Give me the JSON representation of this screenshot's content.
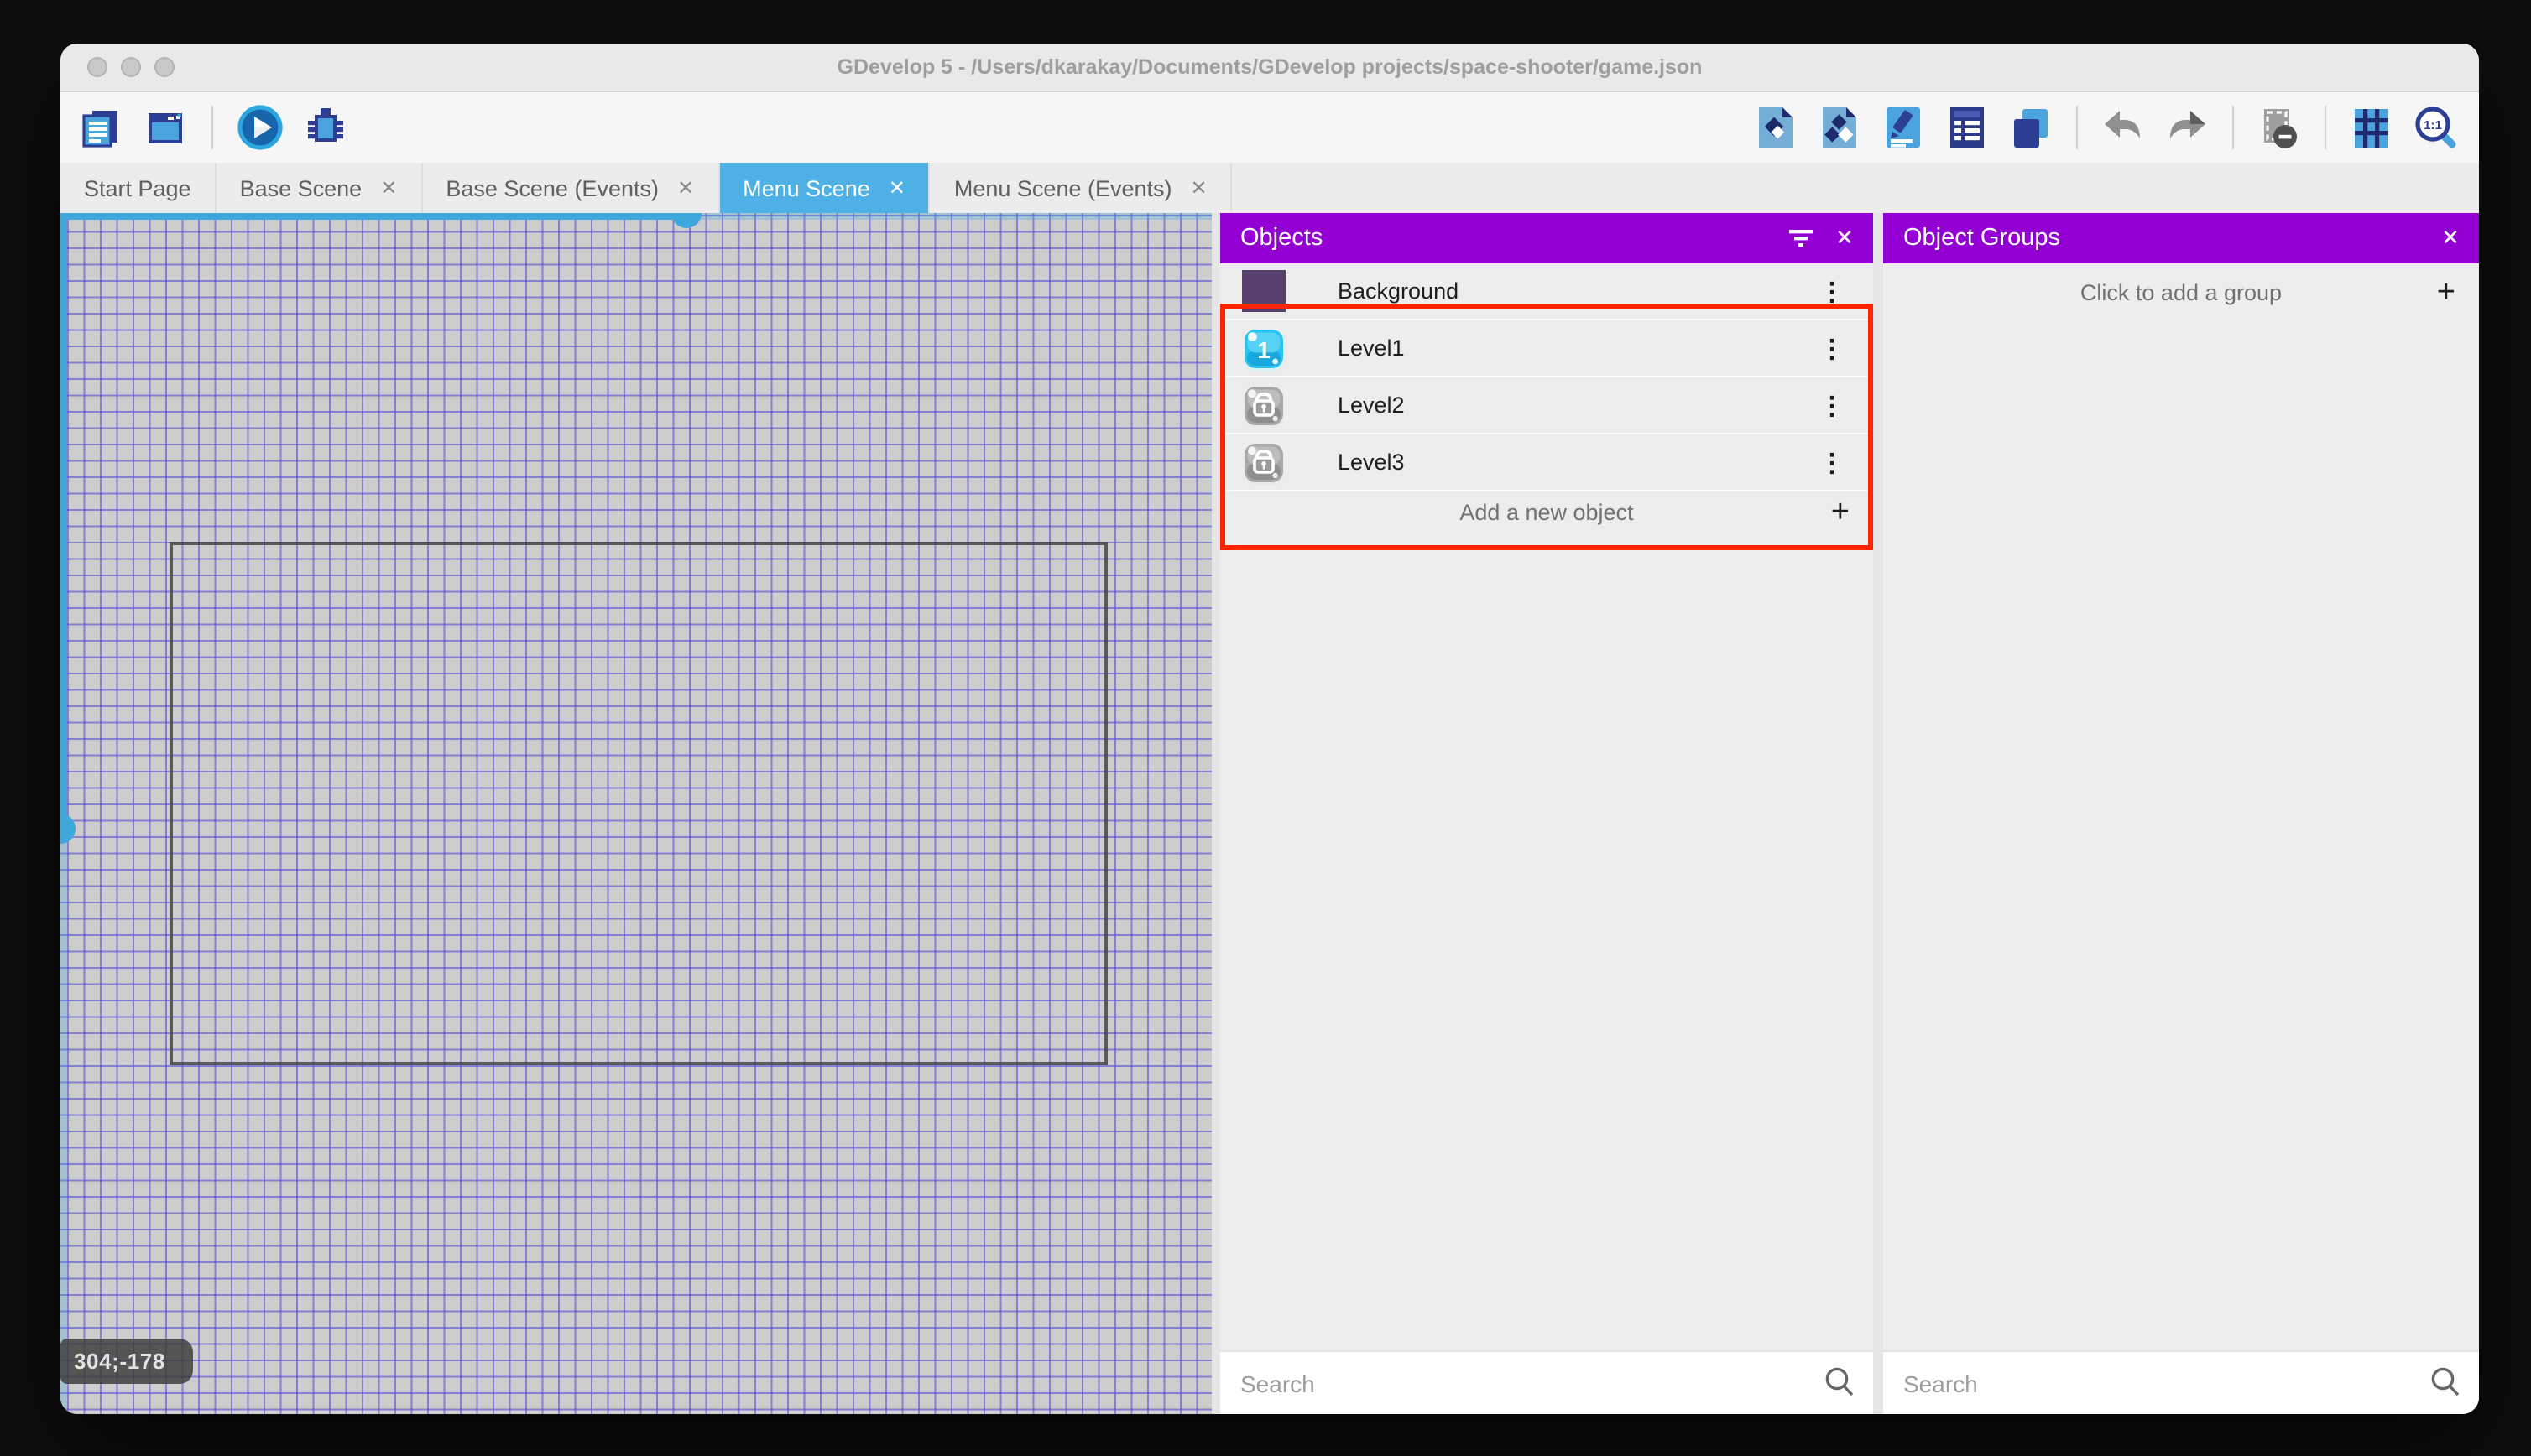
{
  "window": {
    "title": "GDevelop 5 - /Users/dkarakay/Documents/GDevelop projects/space-shooter/game.json"
  },
  "toolbar": {
    "left_icons": [
      "project-manager-icon",
      "start-page-icon",
      "play-icon",
      "debug-icon"
    ],
    "right_icons": [
      "objects-panel-icon",
      "object-groups-panel-icon",
      "properties-panel-icon",
      "instances-list-panel-icon",
      "layers-panel-icon",
      "undo-icon",
      "redo-icon",
      "window-mask-icon",
      "grid-icon",
      "zoom-original-icon"
    ]
  },
  "tabs": [
    {
      "label": "Start Page",
      "closable": false,
      "active": false
    },
    {
      "label": "Base Scene",
      "closable": true,
      "active": false
    },
    {
      "label": "Base Scene (Events)",
      "closable": true,
      "active": false
    },
    {
      "label": "Menu Scene",
      "closable": true,
      "active": true
    },
    {
      "label": "Menu Scene (Events)",
      "closable": true,
      "active": false
    }
  ],
  "scene_editor": {
    "coordinates_badge": "304;-178"
  },
  "objects_panel": {
    "title": "Objects",
    "items": [
      {
        "name": "Background",
        "icon": "background-thumbnail"
      },
      {
        "name": "Level1",
        "icon": "level1-button-icon"
      },
      {
        "name": "Level2",
        "icon": "locked-button-icon"
      },
      {
        "name": "Level3",
        "icon": "locked-button-icon"
      }
    ],
    "add_button_label": "Add a new object",
    "search_placeholder": "Search"
  },
  "object_groups_panel": {
    "title": "Object Groups",
    "add_group_label": "Click to add a group",
    "search_placeholder": "Search"
  },
  "colors": {
    "accent_purple": "#9400d3",
    "highlight_red": "#ff2400",
    "active_tab_blue": "#4fb0e6",
    "grid_line_blue": "#7b72e2",
    "scroll_indicator_blue": "#3ea7dc",
    "canvas_gray": "#cdcdcd"
  }
}
